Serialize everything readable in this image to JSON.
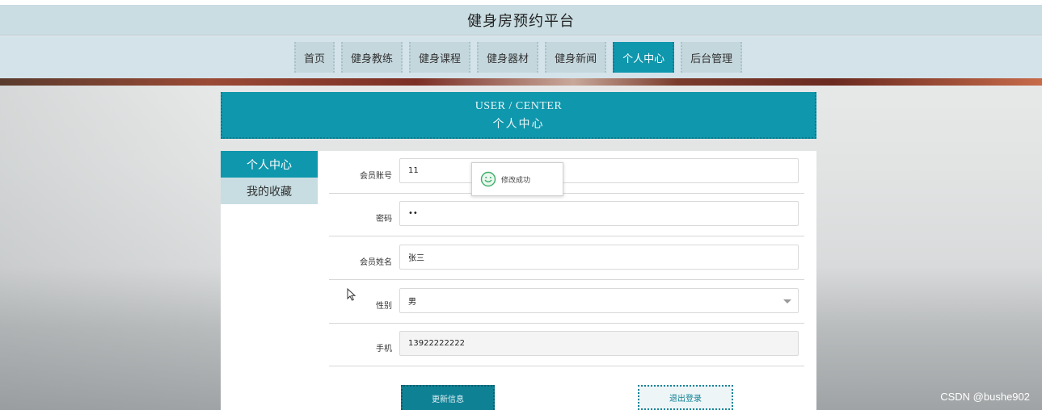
{
  "header": {
    "title": "健身房预约平台"
  },
  "nav": {
    "items": [
      {
        "label": "首页",
        "active": false
      },
      {
        "label": "健身教练",
        "active": false
      },
      {
        "label": "健身课程",
        "active": false
      },
      {
        "label": "健身器材",
        "active": false
      },
      {
        "label": "健身新闻",
        "active": false
      },
      {
        "label": "个人中心",
        "active": true
      },
      {
        "label": "后台管理",
        "active": false
      }
    ]
  },
  "page_banner": {
    "title_en": "USER / CENTER",
    "title_cn": "个人中心"
  },
  "sidebar": {
    "items": [
      {
        "label": "个人中心",
        "active": true
      },
      {
        "label": "我的收藏",
        "active": false
      }
    ]
  },
  "form": {
    "account": {
      "label": "会员账号",
      "value": "11"
    },
    "password": {
      "label": "密码",
      "value": "••"
    },
    "name": {
      "label": "会员姓名",
      "value": "张三"
    },
    "gender": {
      "label": "性别",
      "value": "男"
    },
    "phone": {
      "label": "手机",
      "value": "13922222222"
    },
    "update_button": "更新信息",
    "logout_button": "退出登录"
  },
  "toast": {
    "message": "修改成功",
    "icon": "smile-icon"
  },
  "watermark": "CSDN @bushe902",
  "colors": {
    "accent": "#0f97ad",
    "header_bg": "#c9dde2",
    "nav_bg": "#d4e3ea"
  }
}
